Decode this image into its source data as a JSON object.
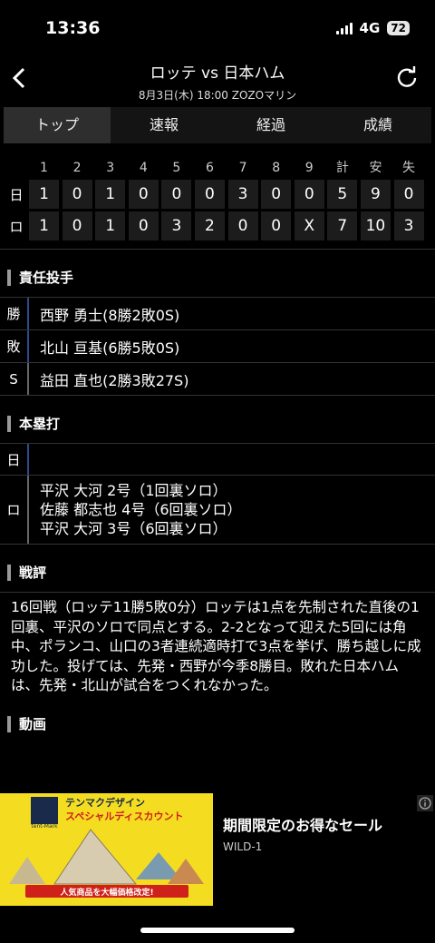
{
  "status": {
    "time": "13:36",
    "network": "4G",
    "battery": "72"
  },
  "header": {
    "title": "ロッテ vs 日本ハム",
    "subtitle": "8月3日(木) 18:00 ZOZOマリン"
  },
  "tabs": [
    "トップ",
    "速報",
    "経過",
    "成績"
  ],
  "scoreboard": {
    "headers": [
      "1",
      "2",
      "3",
      "4",
      "5",
      "6",
      "7",
      "8",
      "9",
      "計",
      "安",
      "失"
    ],
    "rows": [
      {
        "team": "日",
        "cells": [
          "1",
          "0",
          "1",
          "0",
          "0",
          "0",
          "3",
          "0",
          "0",
          "5",
          "9",
          "0"
        ]
      },
      {
        "team": "ロ",
        "cells": [
          "1",
          "0",
          "1",
          "0",
          "3",
          "2",
          "0",
          "0",
          "X",
          "7",
          "10",
          "3"
        ]
      }
    ]
  },
  "pitchers": {
    "title": "責任投手",
    "rows": [
      {
        "label": "勝",
        "value": "西野 勇士(8勝2敗0S)"
      },
      {
        "label": "敗",
        "value": "北山 亘基(6勝5敗0S)"
      },
      {
        "label": "S",
        "value": "益田 直也(2勝3敗27S)"
      }
    ]
  },
  "homeruns": {
    "title": "本塁打",
    "rows": [
      {
        "label": "日",
        "lines": []
      },
      {
        "label": "ロ",
        "lines": [
          "平沢 大河 2号（1回裏ソロ）",
          "佐藤 都志也 4号（6回裏ソロ）",
          "平沢 大河 3号（6回裏ソロ）"
        ]
      }
    ]
  },
  "review": {
    "title": "戦評",
    "text": "16回戦（ロッテ11勝5敗0分）ロッテは1点を先制された直後の1回裏、平沢のソロで同点とする。2-2となって迎えた5回には角中、ポランコ、山口の3者連続適時打で3点を挙げ、勝ち越しに成功した。投げては、先発・西野が今季8勝目。敗れた日本ハムは、先発・北山が試合をつくれなかった。"
  },
  "video": {
    "title": "動画"
  },
  "ad": {
    "headline": "期間限定のお得なセール",
    "brand": "WILD-1",
    "img_title_1": "テンマクデザイン",
    "img_title_2": "スペシャルディスカウント",
    "img_banner": "人気商品を大幅価格改定!",
    "img_logo": "tent-Mark"
  }
}
